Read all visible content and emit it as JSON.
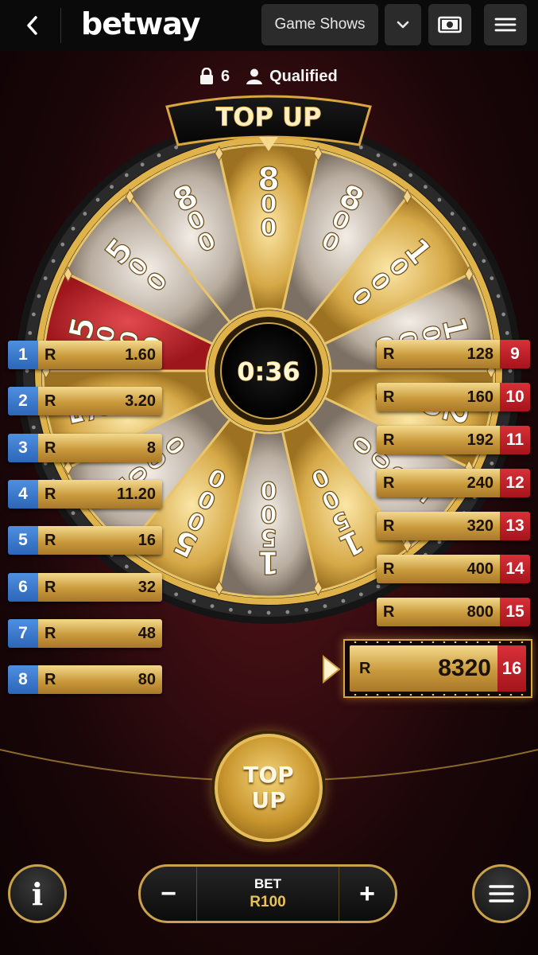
{
  "header": {
    "back_icon": "chevron-left-icon",
    "brand": "betway",
    "category": "Game Shows",
    "dropdown_icon": "chevron-down-icon",
    "cash_icon": "banknote-icon",
    "menu_icon": "hamburger-icon"
  },
  "stats": {
    "lock_icon": "lock-icon",
    "locked_count": "6",
    "user_icon": "user-icon",
    "status": "Qualified"
  },
  "wheel": {
    "banner": "TOP UP",
    "timer": "0:36",
    "segments": [
      "800",
      "800",
      "1000",
      "1000",
      "2000",
      "5000",
      "1500",
      "1500",
      "5000",
      "2000",
      "5000",
      "5000",
      "500",
      "800"
    ],
    "colors": {
      "gold": "#d9ac4a",
      "silver": "#cfc6bb",
      "red": "#c2252c",
      "rim": "#e0b34a"
    }
  },
  "payouts_left": [
    {
      "index": "1",
      "currency": "R",
      "value": "1.60"
    },
    {
      "index": "2",
      "currency": "R",
      "value": "3.20"
    },
    {
      "index": "3",
      "currency": "R",
      "value": "8"
    },
    {
      "index": "4",
      "currency": "R",
      "value": "11.20"
    },
    {
      "index": "5",
      "currency": "R",
      "value": "16"
    },
    {
      "index": "6",
      "currency": "R",
      "value": "32"
    },
    {
      "index": "7",
      "currency": "R",
      "value": "48"
    },
    {
      "index": "8",
      "currency": "R",
      "value": "80"
    }
  ],
  "payouts_right": [
    {
      "index": "9",
      "currency": "R",
      "value": "128"
    },
    {
      "index": "10",
      "currency": "R",
      "value": "160"
    },
    {
      "index": "11",
      "currency": "R",
      "value": "192"
    },
    {
      "index": "12",
      "currency": "R",
      "value": "240"
    },
    {
      "index": "13",
      "currency": "R",
      "value": "320"
    },
    {
      "index": "14",
      "currency": "R",
      "value": "400"
    },
    {
      "index": "15",
      "currency": "R",
      "value": "800"
    }
  ],
  "current_payout": {
    "index": "16",
    "currency": "R",
    "value": "8320"
  },
  "topup_button": {
    "line1": "TOP",
    "line2": "UP"
  },
  "bet": {
    "label": "BET",
    "value": "R100",
    "minus": "−",
    "plus": "+"
  },
  "info_icon": "info-icon",
  "info_label": "i",
  "game_menu_icon": "hamburger-icon"
}
